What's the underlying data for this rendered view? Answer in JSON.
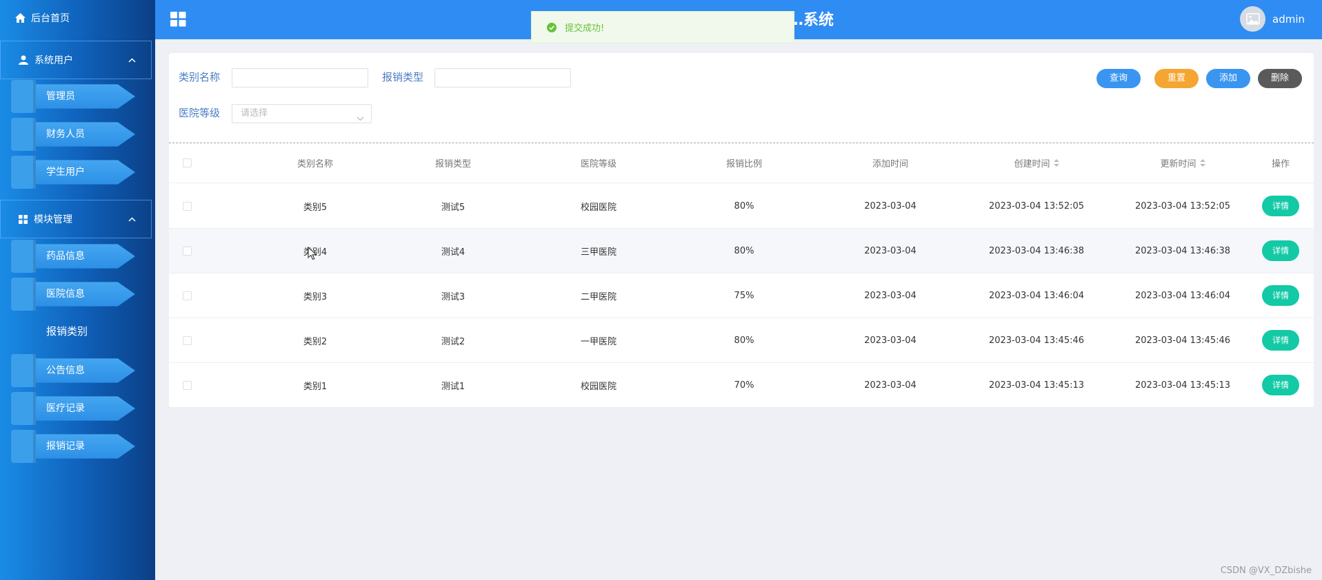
{
  "sidebar": {
    "home": "后台首页",
    "groups": [
      {
        "label": "系统用户",
        "items": [
          "管理员",
          "财务人员",
          "学生用户"
        ]
      },
      {
        "label": "模块管理",
        "items": [
          "药品信息",
          "医院信息",
          "报销类别",
          "公告信息",
          "医疗记录",
          "报销记录"
        ]
      }
    ],
    "active_item": "报销类别"
  },
  "header": {
    "title_visible": "…系统",
    "user": "admin"
  },
  "toast": {
    "text": "提交成功!",
    "type": "success"
  },
  "filters": {
    "category_label": "类别名称",
    "category_value": "",
    "type_label": "报销类型",
    "type_value": "",
    "level_label": "医院等级",
    "level_placeholder": "请选择"
  },
  "buttons": {
    "query": "查询",
    "reset": "重置",
    "add": "添加",
    "delete": "删除"
  },
  "table": {
    "headers": [
      "类别名称",
      "报销类型",
      "医院等级",
      "报销比例",
      "添加时间",
      "创建时间",
      "更新时间",
      "操作"
    ],
    "rows": [
      {
        "name": "类别5",
        "type": "测试5",
        "level": "校园医院",
        "ratio": "80%",
        "added": "2023-03-04",
        "created": "2023-03-04 13:52:05",
        "updated": "2023-03-04 13:52:05",
        "action": "详情"
      },
      {
        "name": "类别4",
        "type": "测试4",
        "level": "三甲医院",
        "ratio": "80%",
        "added": "2023-03-04",
        "created": "2023-03-04 13:46:38",
        "updated": "2023-03-04 13:46:38",
        "action": "详情"
      },
      {
        "name": "类别3",
        "type": "测试3",
        "level": "二甲医院",
        "ratio": "75%",
        "added": "2023-03-04",
        "created": "2023-03-04 13:46:04",
        "updated": "2023-03-04 13:46:04",
        "action": "详情"
      },
      {
        "name": "类别2",
        "type": "测试2",
        "level": "一甲医院",
        "ratio": "80%",
        "added": "2023-03-04",
        "created": "2023-03-04 13:45:46",
        "updated": "2023-03-04 13:45:46",
        "action": "详情"
      },
      {
        "name": "类别1",
        "type": "测试1",
        "level": "校园医院",
        "ratio": "70%",
        "added": "2023-03-04",
        "created": "2023-03-04 13:45:13",
        "updated": "2023-03-04 13:45:13",
        "action": "详情"
      }
    ]
  },
  "watermark": "CSDN @VX_DZbishe",
  "colors": {
    "header": "#2f8cf3",
    "detail_button": "#13c9a6",
    "reset_button": "#f4a532",
    "delete_button": "#5a5a5a",
    "toast_text": "#67c23a"
  }
}
